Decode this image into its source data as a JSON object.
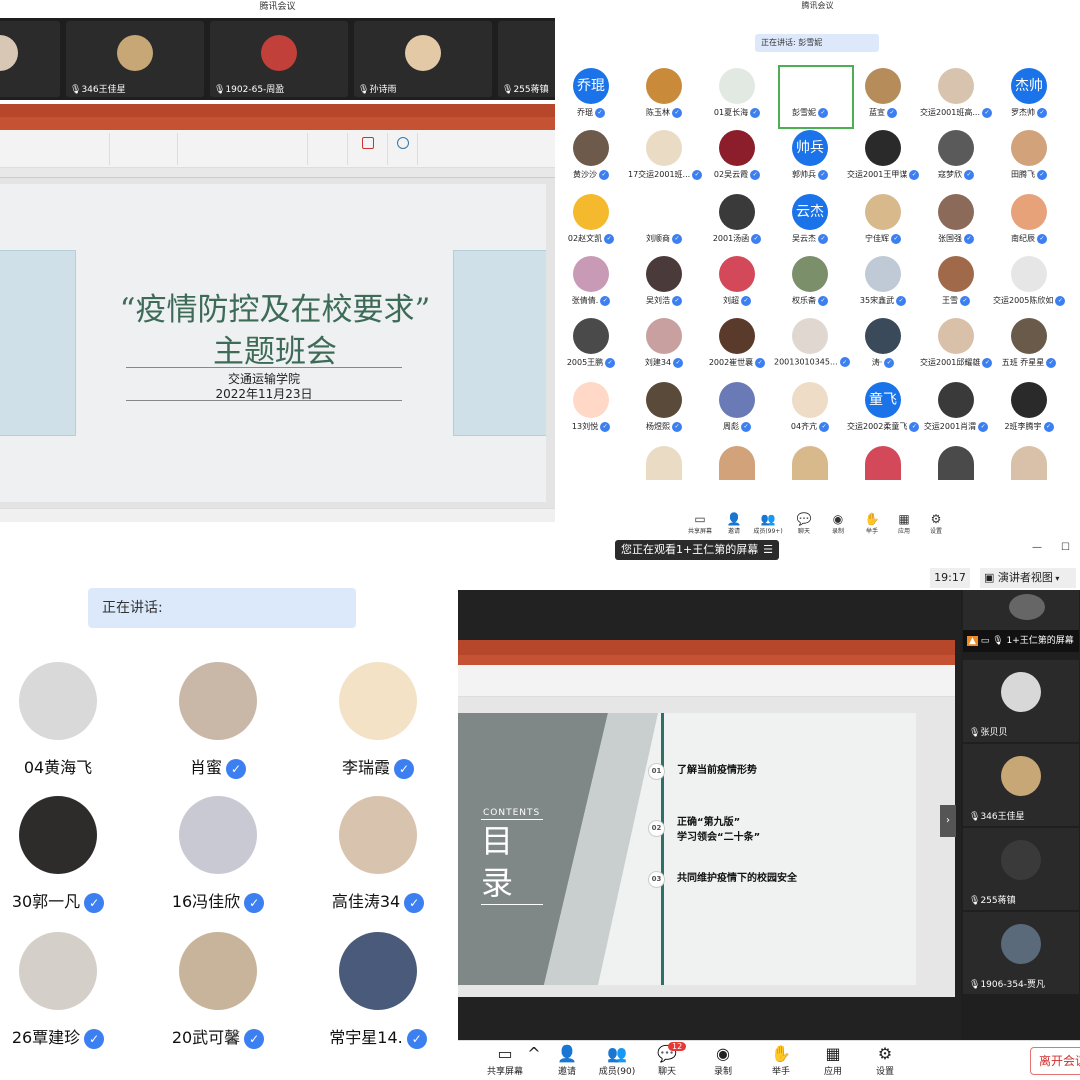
{
  "q1": {
    "title": "腾讯会议",
    "strip": [
      "346王佳星",
      "1902-65-周盈",
      "孙诗雨",
      "255蒋镇"
    ],
    "slide": {
      "title1": "“疫情防控及在校要求”",
      "title2": "主题班会",
      "school": "交通运输学院",
      "date": "2022年11月23日"
    }
  },
  "q2": {
    "title": "腾讯会议",
    "speaking": "正在讲话: 彭雪妮",
    "rows": [
      [
        "乔琨",
        "陈玉林",
        "01夏长海",
        "彭雪妮",
        "蓝宣",
        "交运2001班高...",
        "罗杰帅"
      ],
      [
        "黄沙沙",
        "17交运2001班...",
        "02吴云霞",
        "郭帅兵",
        "交运2001王甲谋",
        "寇梦欣",
        "田腾飞"
      ],
      [
        "02赵文凯",
        "刘顺商",
        "2001汤函",
        "吴云杰",
        "宁佳辉",
        "张国强",
        "南纪辰"
      ],
      [
        "张倩倩.",
        "吴刘浩",
        "刘超",
        "权乐斋",
        "35宋鑫武",
        "王雪",
        "交运2005陈欣如"
      ],
      [
        "2005王鹏",
        "刘建34",
        "2002崔世襄",
        "20013010345...",
        "涛·",
        "交运2001邱耀雄",
        "五班 乔星星"
      ],
      [
        "13刘悦",
        "杨煜熙",
        "周彪",
        "04齐亢",
        "交运2002柔童飞",
        "交运2001肖渭",
        "2班李腾宇"
      ]
    ],
    "textAvatars": {
      "0-0": "乔琨",
      "0-6": "杰帅",
      "1-3": "帅兵",
      "2-3": "云杰",
      "5-4": "童飞"
    },
    "toolbar": [
      "共享屏幕",
      "邀请",
      "成员(99+)",
      "聊天",
      "录制",
      "举手",
      "应用",
      "设置"
    ]
  },
  "q3": {
    "speaking": "正在讲话:",
    "people": [
      "04黄海飞",
      "肖蜜",
      "李瑞霞",
      "30郭一凡",
      "16冯佳欣",
      "高佳涛34",
      "26覃建珍",
      "20武可馨",
      "常宇星14."
    ]
  },
  "q4": {
    "banner": "您正在观看1+王仁第的屏幕",
    "time": "19:17",
    "view": "演讲者视图",
    "contents": "CONTENTS",
    "mulu": "目录",
    "items": [
      {
        "n": "01",
        "t": "了解当前疫情形势"
      },
      {
        "n": "02",
        "t": "正确“第九版”\n学习领会“二十条”"
      },
      {
        "n": "03",
        "t": "共同维护疫情下的校园安全"
      }
    ],
    "side": [
      "1+王仁第的屏幕",
      "张贝贝",
      "346王佳星",
      "255蒋镇",
      "1906-354-贾凡"
    ],
    "toolbar": [
      "共享屏幕",
      "邀请",
      "成员(90)",
      "聊天",
      "录制",
      "举手",
      "应用",
      "设置"
    ],
    "chatBadge": "12",
    "leave": "离开会议"
  }
}
